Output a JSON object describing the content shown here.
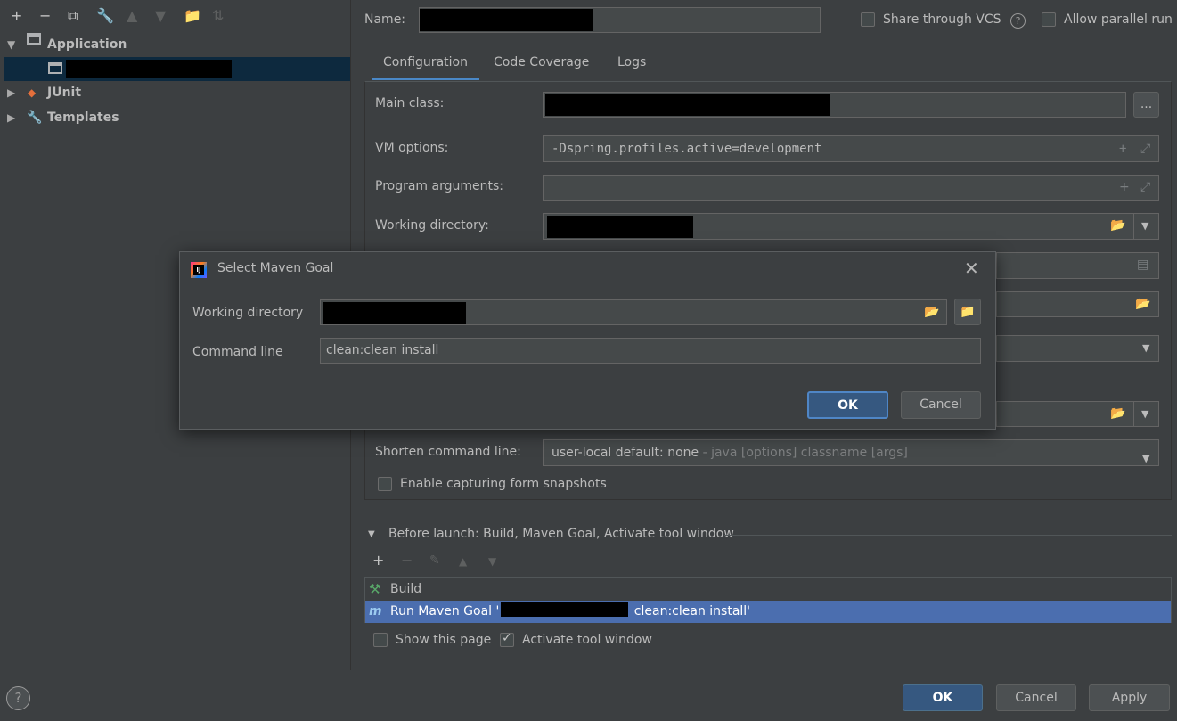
{
  "tree": {
    "items": [
      {
        "label": "Application"
      },
      {
        "label": "JUnit"
      },
      {
        "label": "Templates"
      }
    ]
  },
  "header": {
    "name_label": "Name:",
    "share_vcs_label": "Share through VCS",
    "allow_parallel_label": "Allow parallel run"
  },
  "tabs": [
    "Configuration",
    "Code Coverage",
    "Logs"
  ],
  "config": {
    "main_class_label": "Main class:",
    "vm_options_label": "VM options:",
    "vm_options_value": "-Dspring.profiles.active=development",
    "program_args_label": "Program arguments:",
    "working_dir_label": "Working directory:",
    "shorten_label": "Shorten command line:",
    "shorten_value": "user-local default: none",
    "shorten_hint": " - java [options] classname [args]",
    "capture_label": "Enable capturing form snapshots",
    "browse_label": "..."
  },
  "before_launch": {
    "header": "Before launch: Build, Maven Goal, Activate tool window",
    "items": [
      {
        "label": "Build"
      },
      {
        "label_prefix": "Run Maven Goal '",
        "label_suffix": " clean:clean install'"
      }
    ],
    "show_page_label": "Show this page",
    "activate_label": "Activate tool window"
  },
  "buttons": {
    "ok": "OK",
    "cancel": "Cancel",
    "apply": "Apply"
  },
  "modal": {
    "title": "Select Maven Goal",
    "working_dir_label": "Working directory",
    "command_line_label": "Command line",
    "command_line_value": "clean:clean install",
    "ok": "OK",
    "cancel": "Cancel"
  },
  "colors": {
    "background": "#3c3f41",
    "selection": "#4b6eaf",
    "default_button": "#365880"
  }
}
